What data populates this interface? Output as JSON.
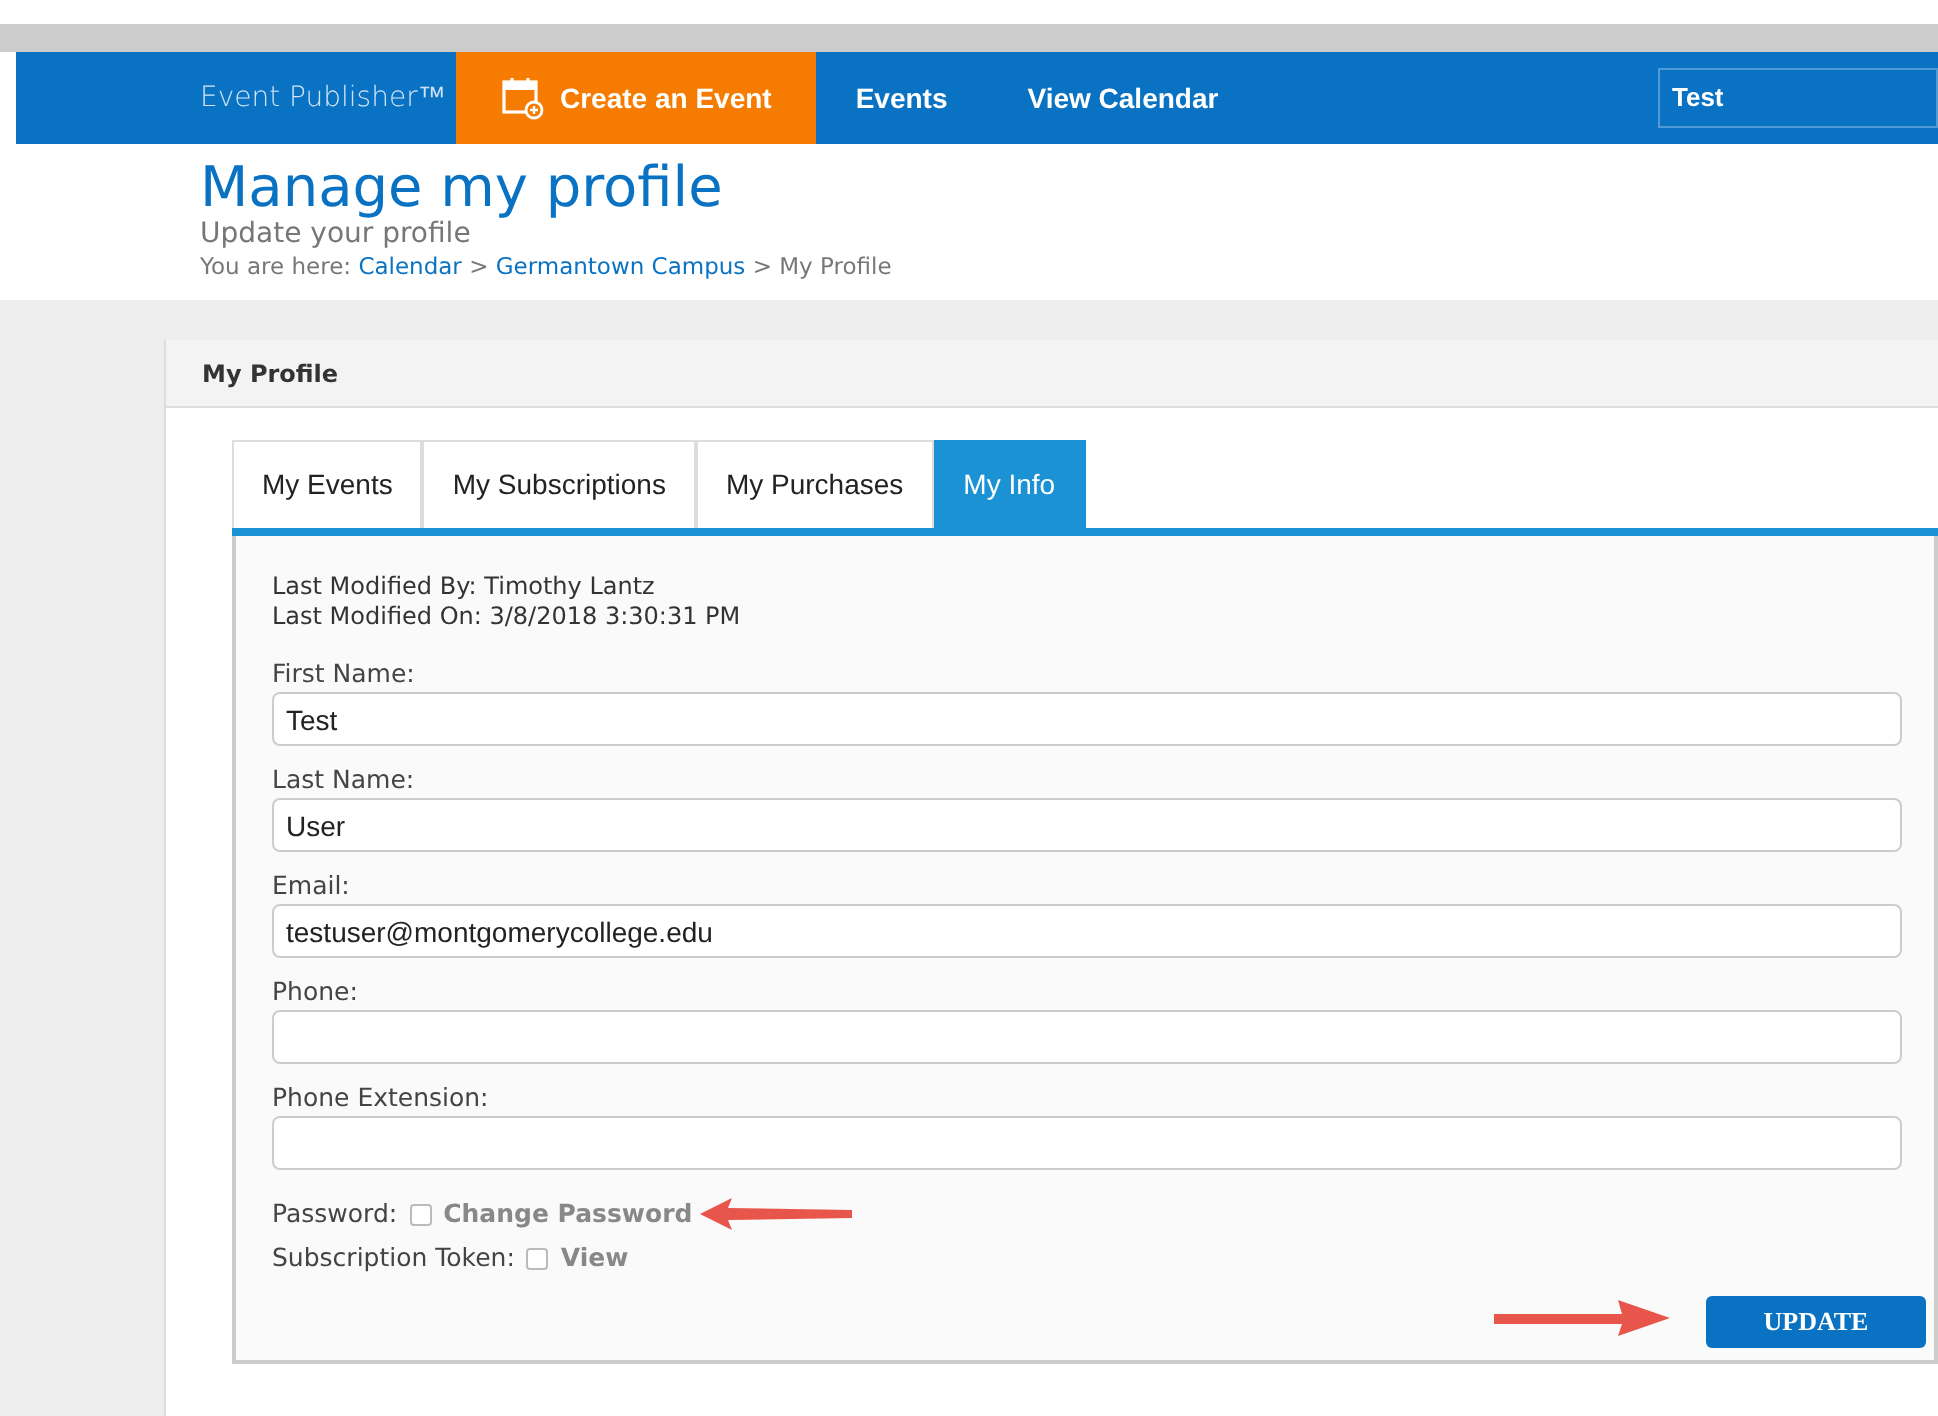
{
  "navbar": {
    "brand": "Event Publisher™",
    "items": [
      {
        "label": "Create an Event",
        "kind": "primary"
      },
      {
        "label": "Events",
        "kind": "link"
      },
      {
        "label": "View Calendar",
        "kind": "link"
      }
    ],
    "user_select": "Test"
  },
  "header": {
    "title": "Manage my profile",
    "subtitle": "Update your profile",
    "breadcrumb_label": "You are here:",
    "breadcrumb_separator": ">",
    "breadcrumb": [
      {
        "label": "Calendar",
        "link": true
      },
      {
        "label": "Germantown Campus",
        "link": true
      },
      {
        "label": "My Profile",
        "link": false
      }
    ]
  },
  "panel": {
    "title": "My Profile",
    "tabs": [
      {
        "label": "My Events",
        "selected": false
      },
      {
        "label": "My Subscriptions",
        "selected": false
      },
      {
        "label": "My Purchases",
        "selected": false
      },
      {
        "label": "My Info",
        "selected": true
      }
    ],
    "meta": [
      "Last Modified By: Timothy Lantz",
      "Last Modified On: 3/8/2018 3:30:31 PM"
    ],
    "fields": [
      {
        "label": "First Name:",
        "value": "Test"
      },
      {
        "label": "Last Name:",
        "value": "User"
      },
      {
        "label": "Email:",
        "value": "testuser@montgomerycollege.edu"
      },
      {
        "label": "Phone:"
      },
      {
        "label": "Phone Extension:"
      }
    ],
    "options": [
      {
        "label": "Password:",
        "action": "Change Password",
        "checked": false,
        "annotated": true
      },
      {
        "label": "Subscription Token:",
        "action": "View",
        "checked": false,
        "annotated": false
      }
    ],
    "update_button": {
      "label": "UPDATE",
      "annotated": true
    }
  }
}
